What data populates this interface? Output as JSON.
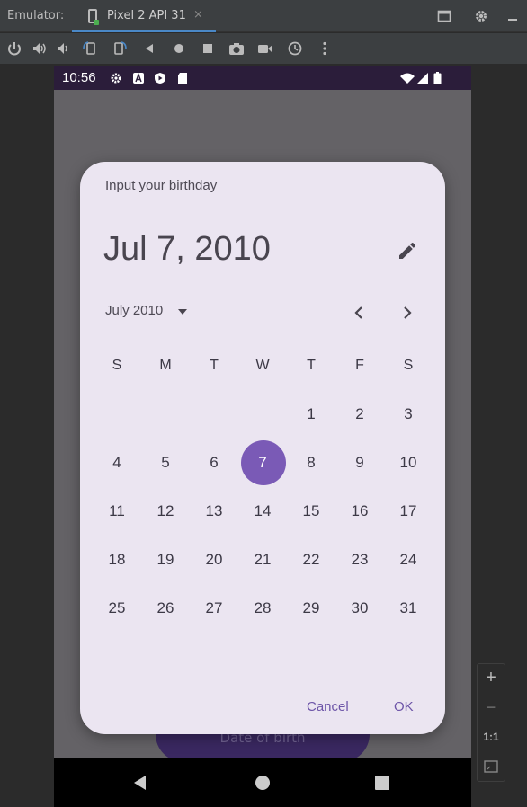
{
  "emulator": {
    "label": "Emulator:",
    "tab_title": "Pixel 2 API 31",
    "tab_close": "×"
  },
  "status": {
    "time": "10:56"
  },
  "background_button": {
    "label": "Date of birth"
  },
  "dialog": {
    "title": "Input your birthday",
    "selected_date_text": "Jul 7, 2010",
    "month_year": "July 2010",
    "weekdays": [
      "S",
      "M",
      "T",
      "W",
      "T",
      "F",
      "S"
    ],
    "weeks": [
      [
        "",
        "",
        "",
        "",
        "1",
        "2",
        "3"
      ],
      [
        "4",
        "5",
        "6",
        "7",
        "8",
        "9",
        "10"
      ],
      [
        "11",
        "12",
        "13",
        "14",
        "15",
        "16",
        "17"
      ],
      [
        "18",
        "19",
        "20",
        "21",
        "22",
        "23",
        "24"
      ],
      [
        "25",
        "26",
        "27",
        "28",
        "29",
        "30",
        "31"
      ]
    ],
    "selected_day": "7",
    "cancel_label": "Cancel",
    "ok_label": "OK"
  },
  "zoom": {
    "plus": "+",
    "minus": "−",
    "one_to_one": "1:1"
  },
  "colors": {
    "accent": "#7a5ab6",
    "dialog_bg": "#ebe5f1",
    "status_bar": "#2b1d3a"
  },
  "icons": [
    "phone-device-icon",
    "power-icon",
    "volume-up-icon",
    "volume-down-icon",
    "rotate-left-icon",
    "rotate-right-icon",
    "back-icon",
    "home-icon",
    "overview-icon",
    "camera-icon",
    "video-icon",
    "snapshot-icon",
    "more-icon",
    "window-icon",
    "settings-gear-icon",
    "edit-pencil-icon",
    "dropdown-arrow-icon",
    "chevron-left-icon",
    "chevron-right-icon",
    "wifi-icon",
    "signal-icon",
    "battery-icon"
  ]
}
